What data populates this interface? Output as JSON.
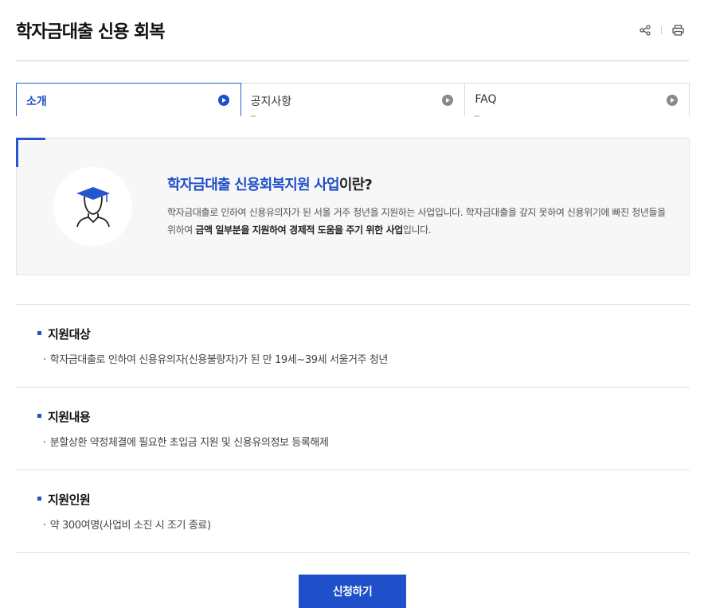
{
  "page": {
    "title": "학자금대출 신용 회복"
  },
  "tools": {
    "share_icon": "share-icon",
    "print_icon": "print-icon"
  },
  "tabs": [
    {
      "label": "소개",
      "active": true
    },
    {
      "label": "공지사항",
      "active": false
    },
    {
      "label": "FAQ",
      "active": false
    }
  ],
  "intro": {
    "title_highlight": "학자금대출 신용회복지원 사업",
    "title_rest": "이란?",
    "desc_part1": "학자금대출로 인하여 신용유의자가 된 서울 거주 청년을 지원하는 사업입니다. 학자금대출을 갚지 못하여 신용위기에 빠진 청년들을 위하여 ",
    "desc_bold": "금액 일부분을 지원하여 경제적 도움을 주기 위한 사업",
    "desc_part2": "입니다.",
    "icon": "graduate-icon"
  },
  "sections": [
    {
      "title": "지원대상",
      "item": "학자금대출로 인하여 신용유의자(신용불량자)가 된 만 19세~39세 서울거주 청년"
    },
    {
      "title": "지원내용",
      "item": "분할상환 약정체결에 필요한 초입금 지원 및 신용유의정보 등록해제"
    },
    {
      "title": "지원인원",
      "item": "약 300여명(사업비 소진 시 조기 종료)"
    }
  ],
  "actions": {
    "apply_label": "신청하기"
  },
  "colors": {
    "accent": "#1f4fc9"
  }
}
